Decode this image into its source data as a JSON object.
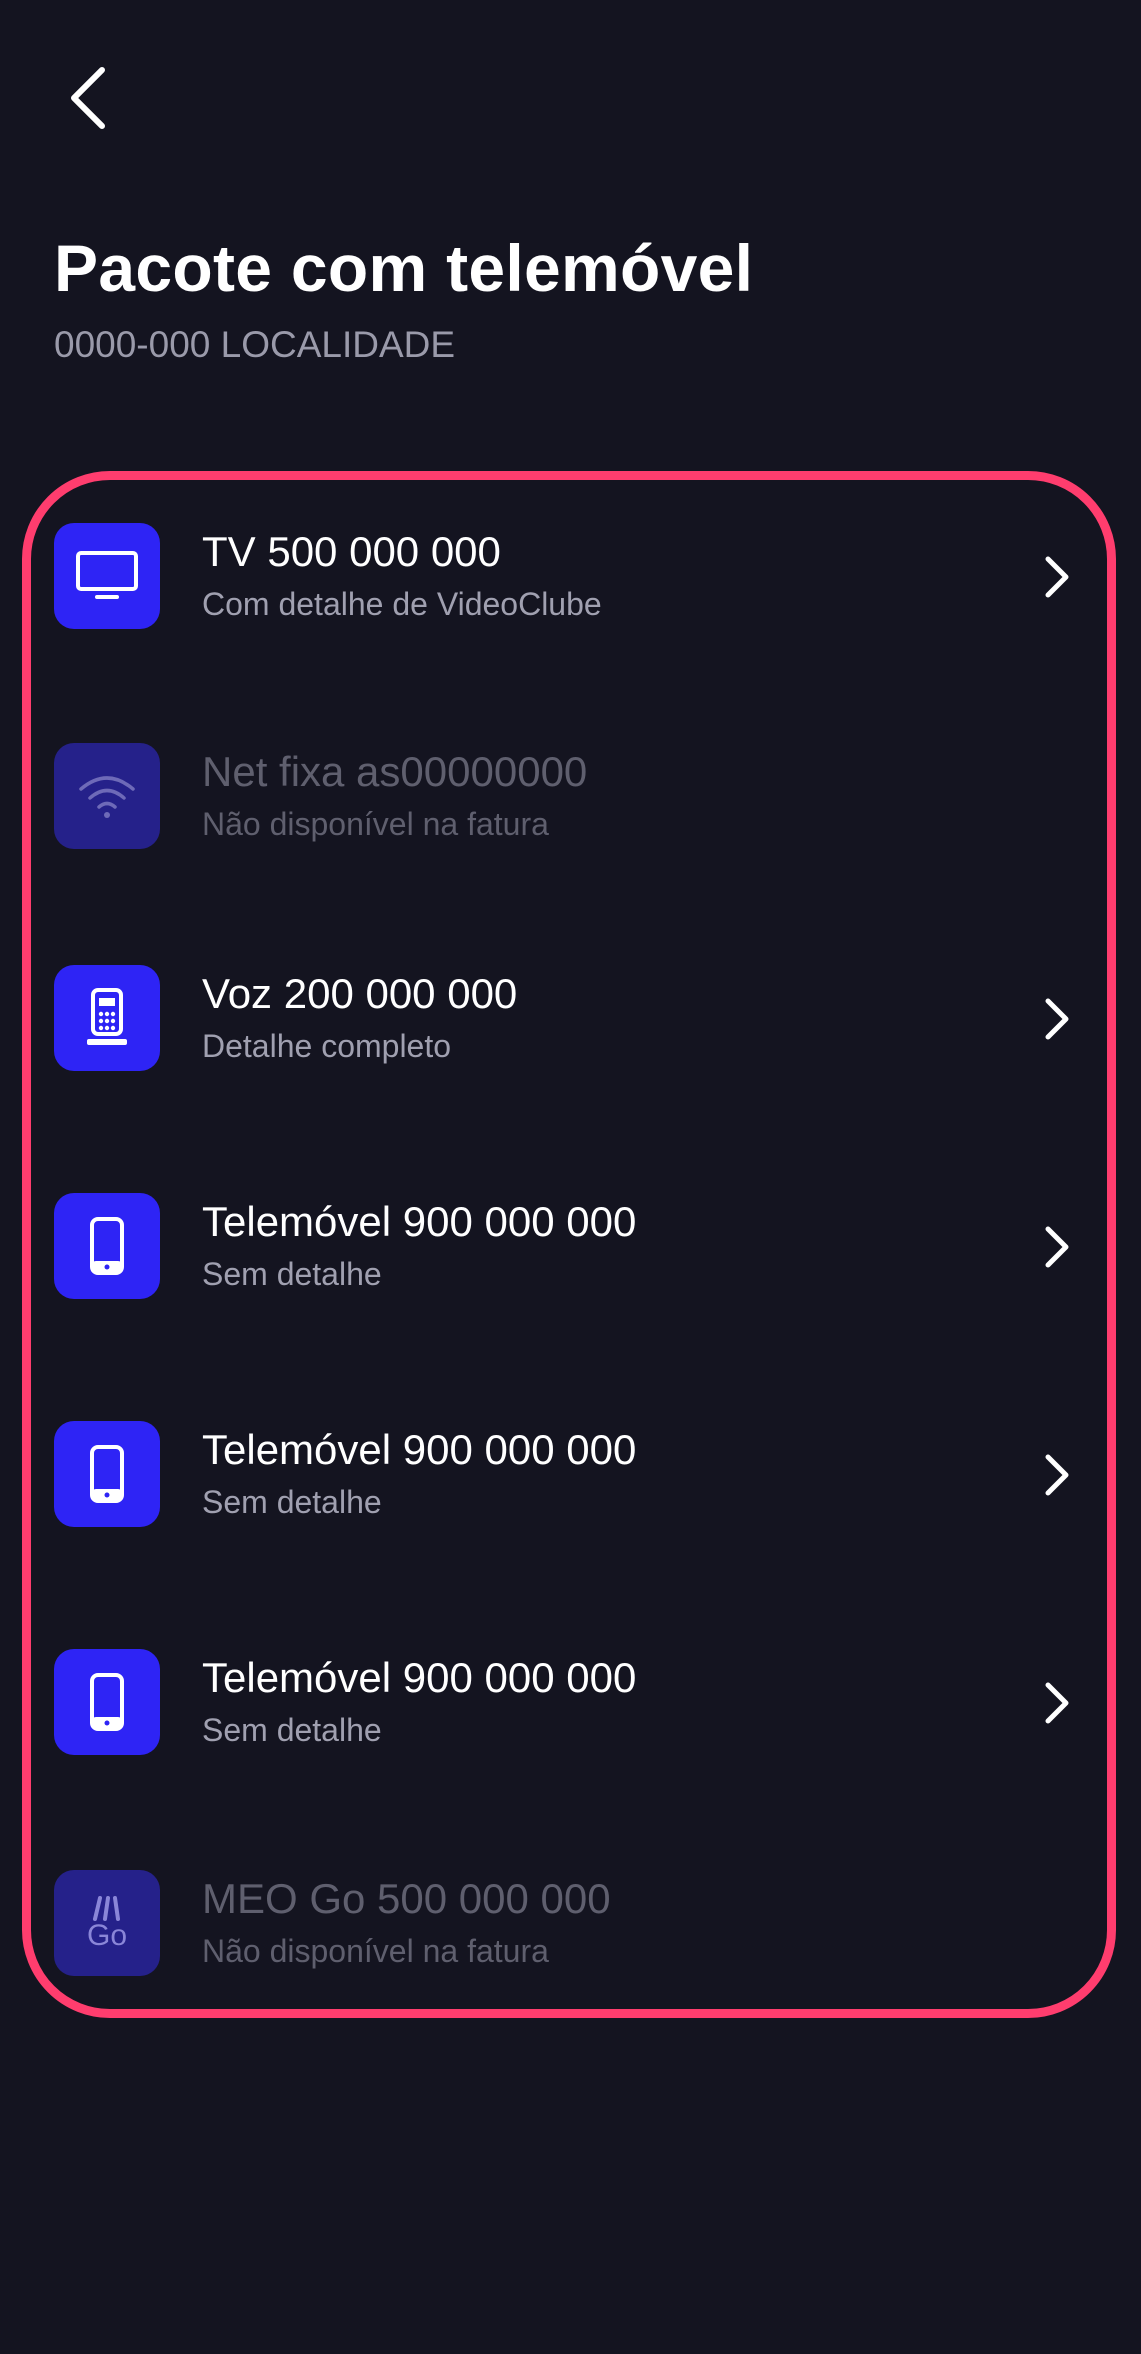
{
  "header": {
    "title": "Pacote com telemóvel",
    "subtitle": "0000-000 LOCALIDADE"
  },
  "colors": {
    "background": "#141420",
    "card_border": "#ff3d6e",
    "icon_active": "#2e24f5",
    "icon_disabled": "#25218a"
  },
  "services": [
    {
      "title": "TV 500 000 000",
      "subtitle": "Com detalhe de VideoClube",
      "icon": "tv-icon",
      "enabled": true
    },
    {
      "title": "Net fixa as00000000",
      "subtitle": "Não disponível na fatura",
      "icon": "wifi-icon",
      "enabled": false
    },
    {
      "title": "Voz 200 000 000",
      "subtitle": "Detalhe completo",
      "icon": "landline-phone-icon",
      "enabled": true
    },
    {
      "title": "Telemóvel 900 000 000",
      "subtitle": "Sem detalhe",
      "icon": "mobile-phone-icon",
      "enabled": true
    },
    {
      "title": "Telemóvel 900 000 000",
      "subtitle": "Sem detalhe",
      "icon": "mobile-phone-icon",
      "enabled": true
    },
    {
      "title": "Telemóvel 900 000 000",
      "subtitle": "Sem detalhe",
      "icon": "mobile-phone-icon",
      "enabled": true
    },
    {
      "title": "MEO Go 500 000 000",
      "subtitle": "Não disponível na fatura",
      "icon": "meo-go-icon",
      "icon_text": "Go",
      "enabled": false
    }
  ]
}
